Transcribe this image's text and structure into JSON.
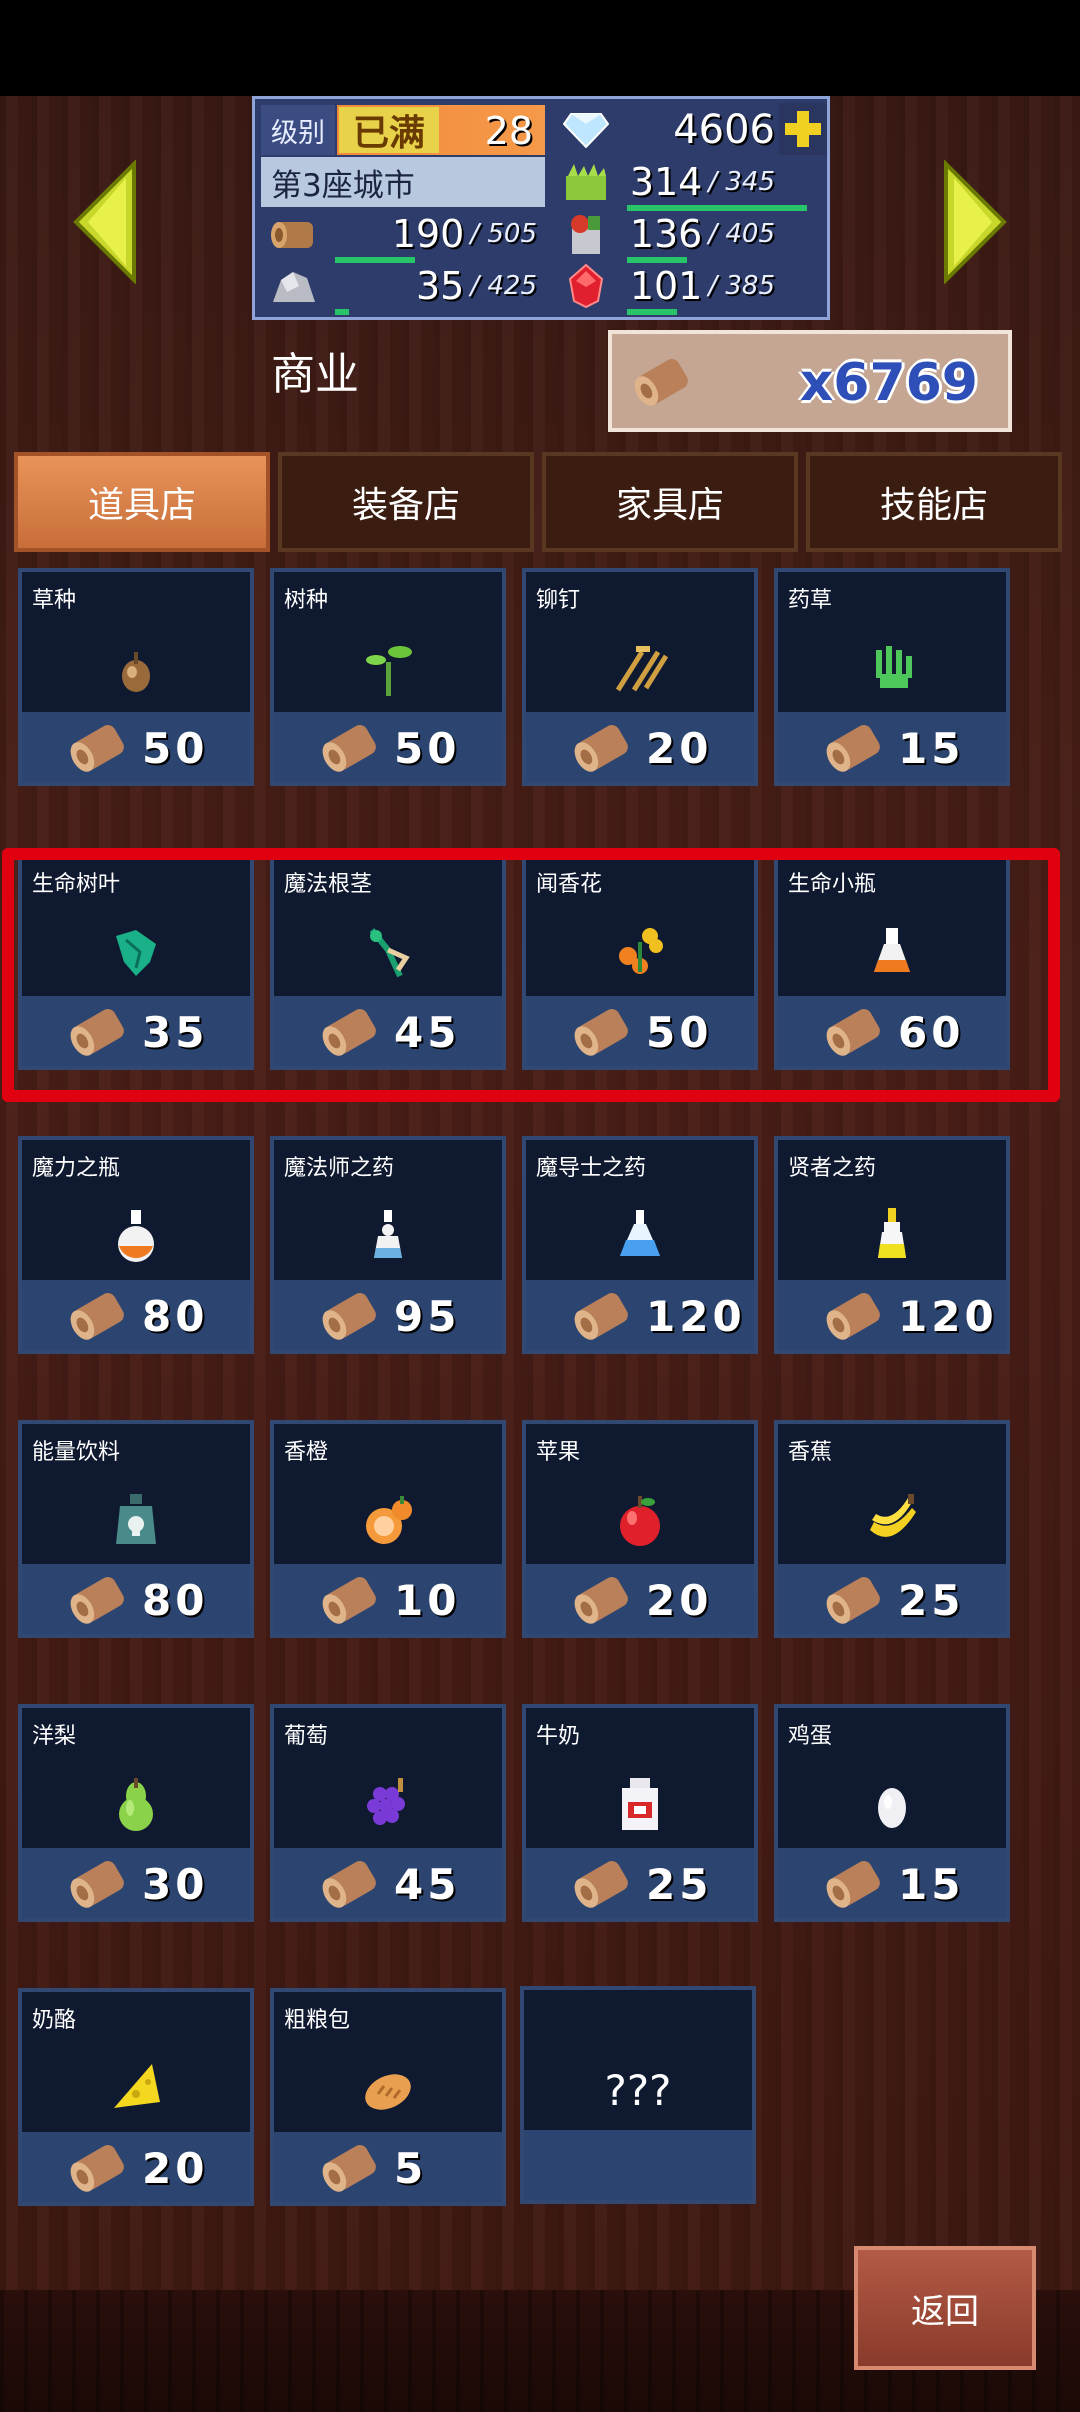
{
  "header": {
    "level_label": "级别",
    "level_max": "已满",
    "level": "28",
    "gems": "4606",
    "city": "第3座城市",
    "resources": [
      {
        "icon": "grass-resource-icon",
        "value": "314",
        "max": "/ 345",
        "fill": 0.91
      },
      {
        "icon": "wood-resource-icon",
        "value": "190",
        "max": "/ 505",
        "fill": 0.38
      },
      {
        "icon": "food-resource-icon",
        "value": "136",
        "max": "/ 405",
        "fill": 0.34
      },
      {
        "icon": "stone-resource-icon",
        "value": "35",
        "max": "/ 425",
        "fill": 0.08
      },
      {
        "icon": "ruby-resource-icon",
        "value": "101",
        "max": "/ 385",
        "fill": 0.26
      }
    ]
  },
  "shop": {
    "title": "商业",
    "coins": "x6769"
  },
  "tabs": [
    "道具店",
    "装备店",
    "家具店",
    "技能店"
  ],
  "items": [
    {
      "name": "草种",
      "price": "50",
      "icon": "seed-icon"
    },
    {
      "name": "树种",
      "price": "50",
      "icon": "sapling-icon"
    },
    {
      "name": "铆钉",
      "price": "20",
      "icon": "rivet-icon"
    },
    {
      "name": "药草",
      "price": "15",
      "icon": "herb-icon"
    },
    {
      "name": "生命树叶",
      "price": "35",
      "icon": "life-leaf-icon"
    },
    {
      "name": "魔法根茎",
      "price": "45",
      "icon": "magic-root-icon"
    },
    {
      "name": "闻香花",
      "price": "50",
      "icon": "fragrant-flower-icon"
    },
    {
      "name": "生命小瓶",
      "price": "60",
      "icon": "life-potion-icon"
    },
    {
      "name": "魔力之瓶",
      "price": "80",
      "icon": "mana-bottle-icon"
    },
    {
      "name": "魔法师之药",
      "price": "95",
      "icon": "mage-potion-icon"
    },
    {
      "name": "魔导士之药",
      "price": "120",
      "icon": "sorcerer-potion-icon"
    },
    {
      "name": "贤者之药",
      "price": "120",
      "icon": "sage-potion-icon"
    },
    {
      "name": "能量饮料",
      "price": "80",
      "icon": "energy-drink-icon"
    },
    {
      "name": "香橙",
      "price": "10",
      "icon": "orange-icon"
    },
    {
      "name": "苹果",
      "price": "20",
      "icon": "apple-icon"
    },
    {
      "name": "香蕉",
      "price": "25",
      "icon": "banana-icon"
    },
    {
      "name": "洋梨",
      "price": "30",
      "icon": "pear-icon"
    },
    {
      "name": "葡萄",
      "price": "45",
      "icon": "grape-icon"
    },
    {
      "name": "牛奶",
      "price": "25",
      "icon": "milk-icon"
    },
    {
      "name": "鸡蛋",
      "price": "15",
      "icon": "egg-icon"
    },
    {
      "name": "奶酪",
      "price": "20",
      "icon": "cheese-icon"
    },
    {
      "name": "粗粮包",
      "price": "5",
      "icon": "bread-icon"
    }
  ],
  "unknown_label": "???",
  "back_label": "返回"
}
